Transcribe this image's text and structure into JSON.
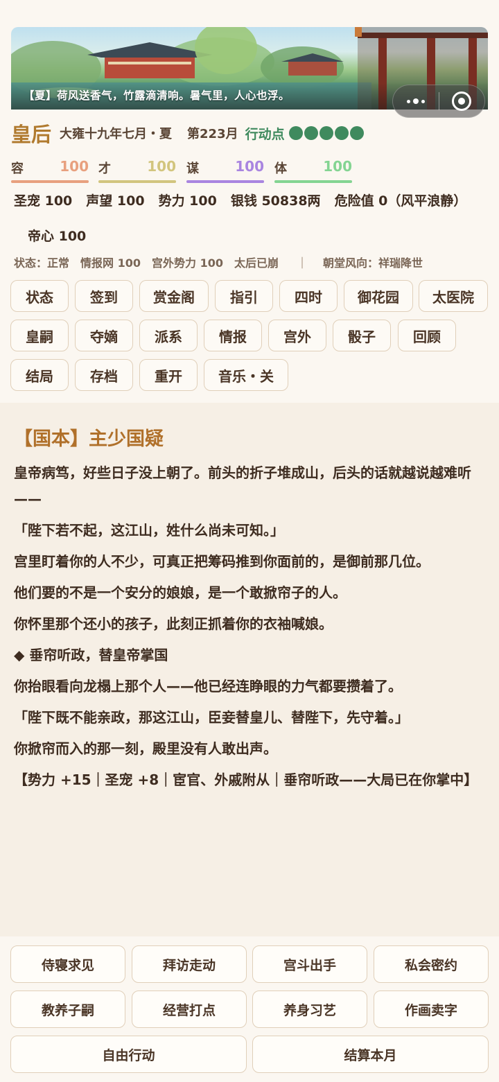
{
  "banner": {
    "caption": "【夏】荷风送香气，竹露滴清响。暑气里，人心也浮。"
  },
  "capsule": {
    "more_icon": "more-dots-icon",
    "close_icon": "target-circle-icon"
  },
  "header": {
    "rank": "皇后",
    "date": "大雍十九年七月・夏",
    "month": "第223月",
    "action_points_label": "行动点",
    "action_points": 5,
    "action_points_color": "#3f8a5e"
  },
  "attributes": [
    {
      "label": "容",
      "value": "100",
      "color": "#e8a07e"
    },
    {
      "label": "才",
      "value": "100",
      "color": "#d2c57e"
    },
    {
      "label": "谋",
      "value": "100",
      "color": "#a985e0"
    },
    {
      "label": "体",
      "value": "100",
      "color": "#84d492"
    }
  ],
  "stats": {
    "favor": "圣宠 100",
    "reputation": "声望 100",
    "power": "势力 100",
    "silver": "银钱 50838两",
    "danger": "危险值 0（风平浪静）",
    "emperor_heart": "帝心 100"
  },
  "status_line": {
    "state": "状态：正常",
    "intel": "情报网 100",
    "outside": "宫外势力 100",
    "empress_dowager": "太后已崩",
    "pipe": "｜",
    "court": "朝堂风向：祥瑞降世"
  },
  "menu": [
    "状态",
    "签到",
    "赏金阁",
    "指引",
    "四时",
    "御花园",
    "太医院",
    "皇嗣",
    "夺嫡",
    "派系",
    "情报",
    "宫外",
    "骰子",
    "回顾",
    "结局",
    "存档",
    "重开",
    "音乐・关"
  ],
  "story": {
    "title": "【国本】主少国疑",
    "paragraphs": [
      "皇帝病笃，好些日子没上朝了。前头的折子堆成山，后头的话就越说越难听——",
      "「陛下若不起，这江山，姓什么尚未可知。」",
      "宫里盯着你的人不少，可真正把筹码推到你面前的，是御前那几位。",
      "他们要的不是一个安分的娘娘，是一个敢掀帘子的人。",
      "你怀里那个还小的孩子，此刻正抓着你的衣袖喊娘。",
      "◆ 垂帘听政，替皇帝掌国",
      "你抬眼看向龙榻上那个人——他已经连睁眼的力气都要攒着了。",
      "「陛下既不能亲政，那这江山，臣妾替皇儿、替陛下，先守着。」",
      "你掀帘而入的那一刻，殿里没有人敢出声。",
      "【势力 +15｜圣宠 +8｜宦官、外戚附从｜垂帘听政——大局已在你掌中】"
    ]
  },
  "actions": [
    "侍寝求见",
    "拜访走动",
    "宫斗出手",
    "私会密约",
    "教养子嗣",
    "经营打点",
    "养身习艺",
    "作画卖字",
    "自由行动",
    "结算本月"
  ]
}
